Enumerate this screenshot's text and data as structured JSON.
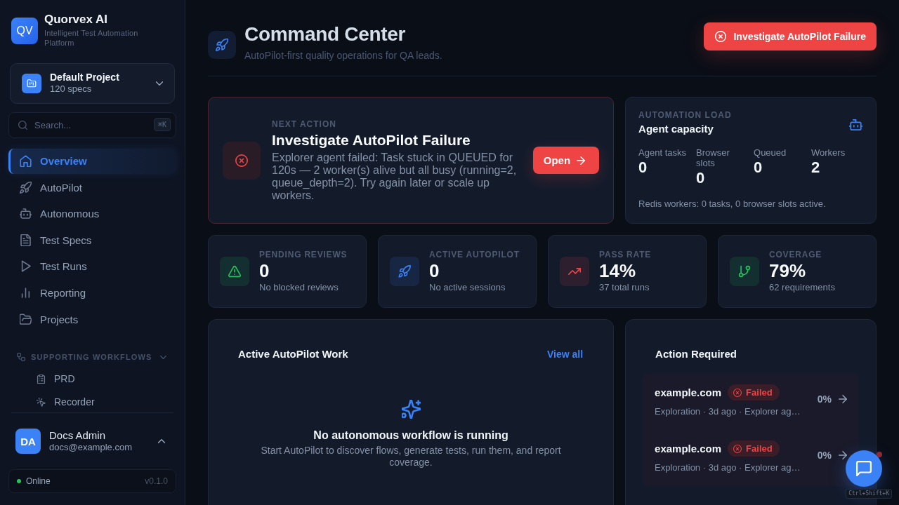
{
  "sidebar": {
    "brand": {
      "logo": "QV",
      "name": "Quorvex AI",
      "tagline": "Intelligent Test Automation Platform"
    },
    "project": {
      "name": "Default Project",
      "specs": "120 specs"
    },
    "search": {
      "placeholder": "Search...",
      "shortcut": "⌘K"
    },
    "nav": [
      {
        "label": "Overview",
        "selected": true
      },
      {
        "label": "AutoPilot",
        "selected": false
      },
      {
        "label": "Autonomous",
        "selected": false
      },
      {
        "label": "Test Specs",
        "selected": false
      },
      {
        "label": "Test Runs",
        "selected": false
      },
      {
        "label": "Reporting",
        "selected": false
      },
      {
        "label": "Projects",
        "selected": false
      }
    ],
    "section": {
      "title": "SUPPORTING WORKFLOWS",
      "expanded": true,
      "items": [
        {
          "label": "PRD",
          "selected": false
        },
        {
          "label": "Recorder",
          "selected": false
        }
      ]
    },
    "user": {
      "initials": "DA",
      "name": "Docs Admin",
      "email": "docs@example.com"
    },
    "status": {
      "label": "Online",
      "online": true,
      "version": "v0.1.0"
    }
  },
  "header": {
    "title": "Command Center",
    "subtitle": "AutoPilot-first quality operations for QA leads.",
    "alert_button": "Investigate AutoPilot Failure"
  },
  "next_action": {
    "eyebrow": "NEXT ACTION",
    "title": "Investigate AutoPilot Failure",
    "description": "Explorer agent failed: Task stuck in QUEUED for 120s — 2 worker(s) alive but all busy (running=2, queue_depth=2). Try again later or scale up workers.",
    "button": "Open"
  },
  "automation_load": {
    "eyebrow": "AUTOMATION LOAD",
    "title": "Agent capacity",
    "metrics": [
      {
        "label": "Agent tasks",
        "value": "0"
      },
      {
        "label": "Browser slots",
        "value": "0"
      },
      {
        "label": "Queued",
        "value": "0"
      },
      {
        "label": "Workers",
        "value": "2"
      }
    ],
    "note": "Redis workers: 0 tasks, 0 browser slots active."
  },
  "stats": [
    {
      "label": "PENDING REVIEWS",
      "value": "0",
      "detail": "No blocked reviews",
      "color": "#22c55e"
    },
    {
      "label": "ACTIVE AUTOPILOT",
      "value": "0",
      "detail": "No active sessions",
      "color": "#3b82f6"
    },
    {
      "label": "PASS RATE",
      "value": "14%",
      "detail": "37 total runs",
      "color": "#ef4444"
    },
    {
      "label": "COVERAGE",
      "value": "79%",
      "detail": "62 requirements",
      "color": "#22c55e"
    }
  ],
  "active_work": {
    "title": "Active AutoPilot Work",
    "link": "View all",
    "empty_title": "No autonomous workflow is running",
    "empty_text": "Start AutoPilot to discover flows, generate tests, run them, and report coverage."
  },
  "action_required": {
    "title": "Action Required",
    "items": [
      {
        "target": "example.com",
        "status": "Failed",
        "meta": "Exploration · 3d ago · Explorer ag…",
        "progress": "0%"
      },
      {
        "target": "example.com",
        "status": "Failed",
        "meta": "Exploration · 3d ago · Explorer ag…",
        "progress": "0%"
      }
    ]
  },
  "chat_widget": {
    "unread": true,
    "shortcut": "Ctrl+Shift+K"
  }
}
